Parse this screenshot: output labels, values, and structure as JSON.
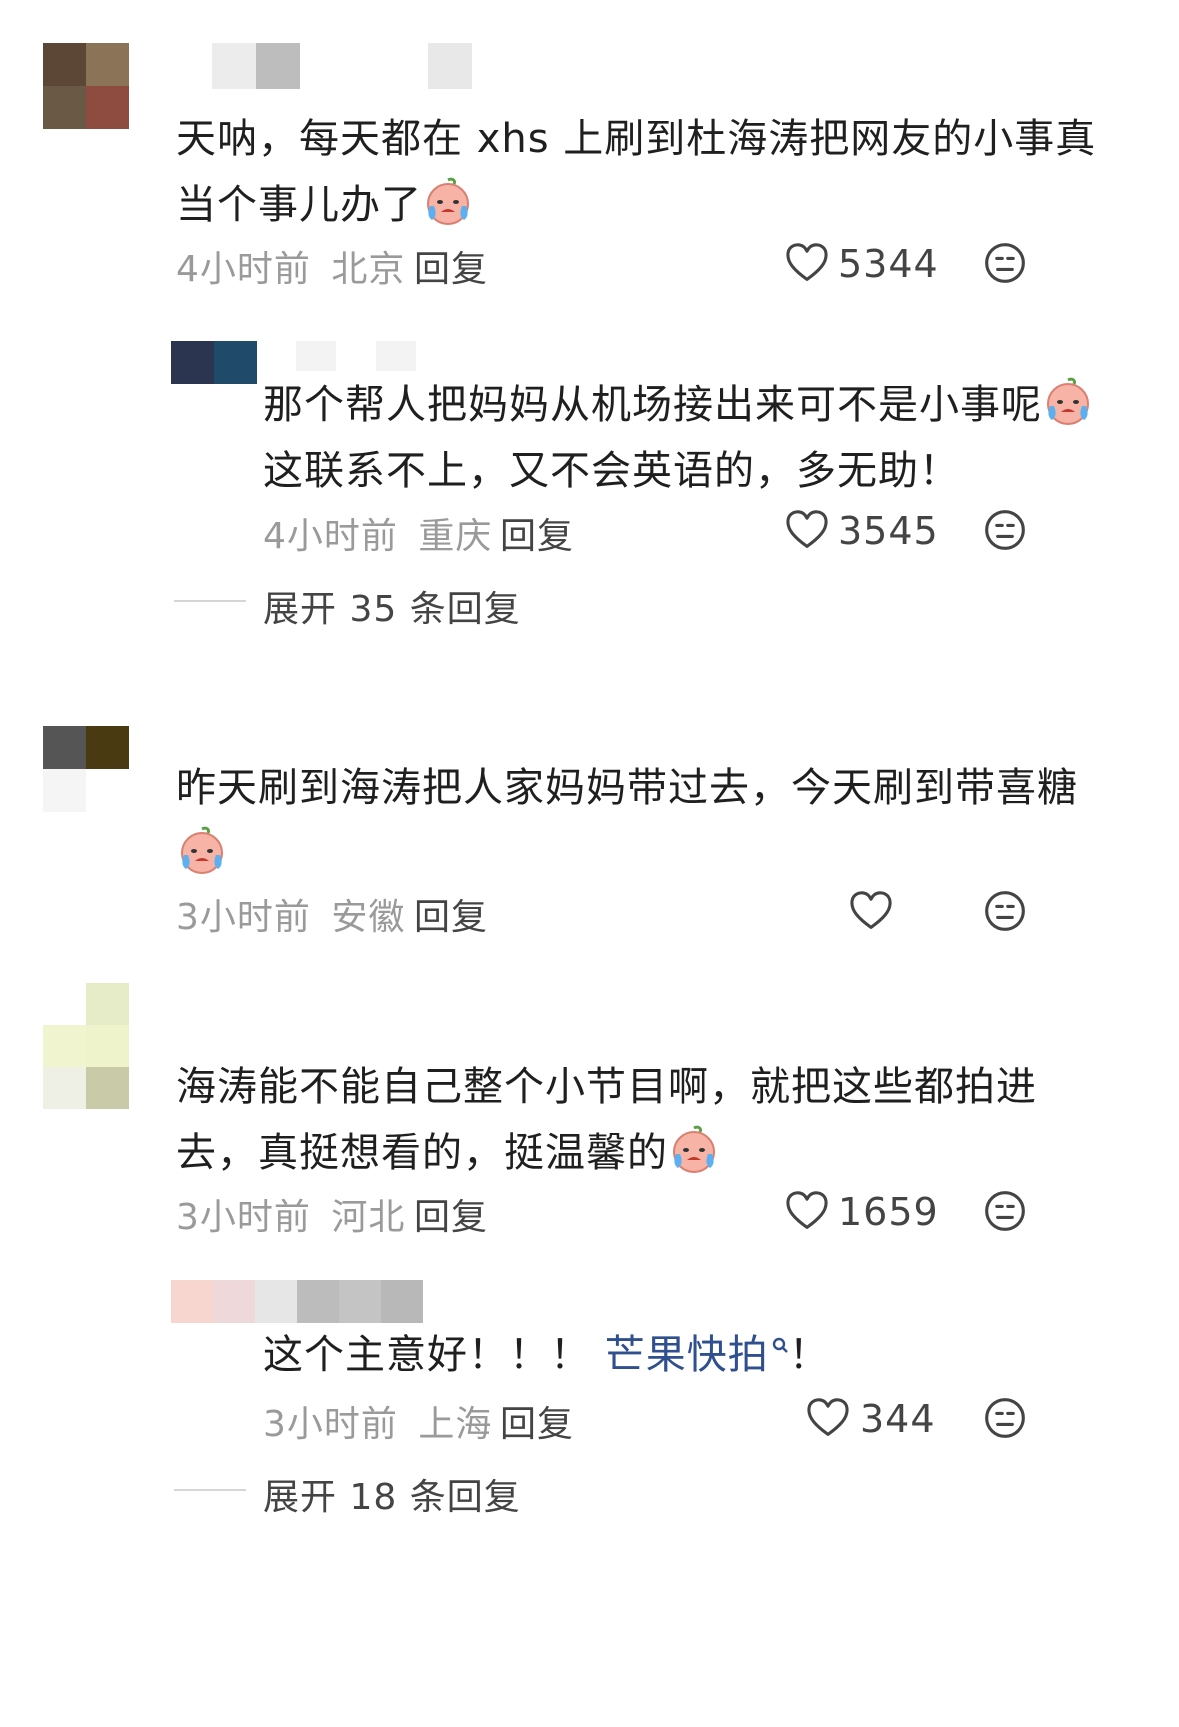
{
  "comments": [
    {
      "text_line1": "天呐，每天都在 xhs 上刷到杜海涛把网友的小事真",
      "text_line2": "当个事儿办了",
      "time": "4小时前",
      "location": "北京",
      "reply_label": "回复",
      "likes": "5344",
      "reply": {
        "text_line1": "那个帮人把妈妈从机场接出来可不是小事呢",
        "text_line2": "这联系不上，又不会英语的，多无助！",
        "time": "4小时前",
        "location": "重庆",
        "reply_label": "回复",
        "likes": "3545"
      },
      "expand_label": "展开 35 条回复"
    },
    {
      "text_line1": "昨天刷到海涛把人家妈妈带过去，今天刷到带喜糖",
      "time": "3小时前",
      "location": "安徽",
      "reply_label": "回复"
    },
    {
      "text_line1": "海涛能不能自己整个小节目啊，就把这些都拍进",
      "text_line2": "去，真挺想看的，挺温馨的",
      "time": "3小时前",
      "location": "河北",
      "reply_label": "回复",
      "likes": "1659",
      "reply": {
        "text_before": "这个主意好！！！ ",
        "link_text": "芒果快拍",
        "text_after": "！",
        "time": "3小时前",
        "location": "上海",
        "reply_label": "回复",
        "likes": "344"
      },
      "expand_label": "展开 18 条回复"
    }
  ],
  "colors": {
    "text": "#1f1f1f",
    "meta": "#9a9a9a",
    "link": "#2f4f8f",
    "icon": "#444444"
  }
}
